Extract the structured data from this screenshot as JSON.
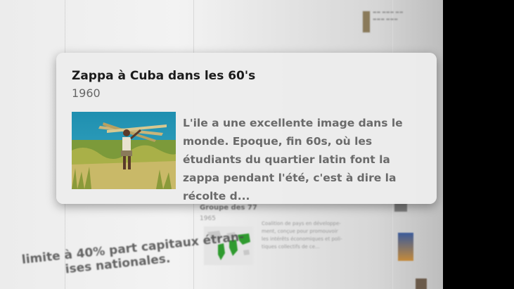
{
  "card": {
    "title": "Zappa à Cuba dans les 60's",
    "year": "1960",
    "body": "L'ile a une excellente image dans le monde. Epoque, fin 60s, où les étudiants du quartier latin font la zappa pendant l'été, c'est à dire la récolte d..."
  },
  "background": {
    "group_title": "Groupe des 77",
    "group_year": "1965",
    "group_desc": [
      "Coalition de pays en développe-",
      "ment, conçue pour promouvoir",
      "les intérêts économiques et poli-",
      "tiques collectifs de ce..."
    ],
    "big_text_1": "limite à 40% part capitaux étran-",
    "big_text_2": "ises nationales."
  },
  "colors": {
    "accent": "#2f9b2f",
    "card_bg": "#ececec"
  }
}
